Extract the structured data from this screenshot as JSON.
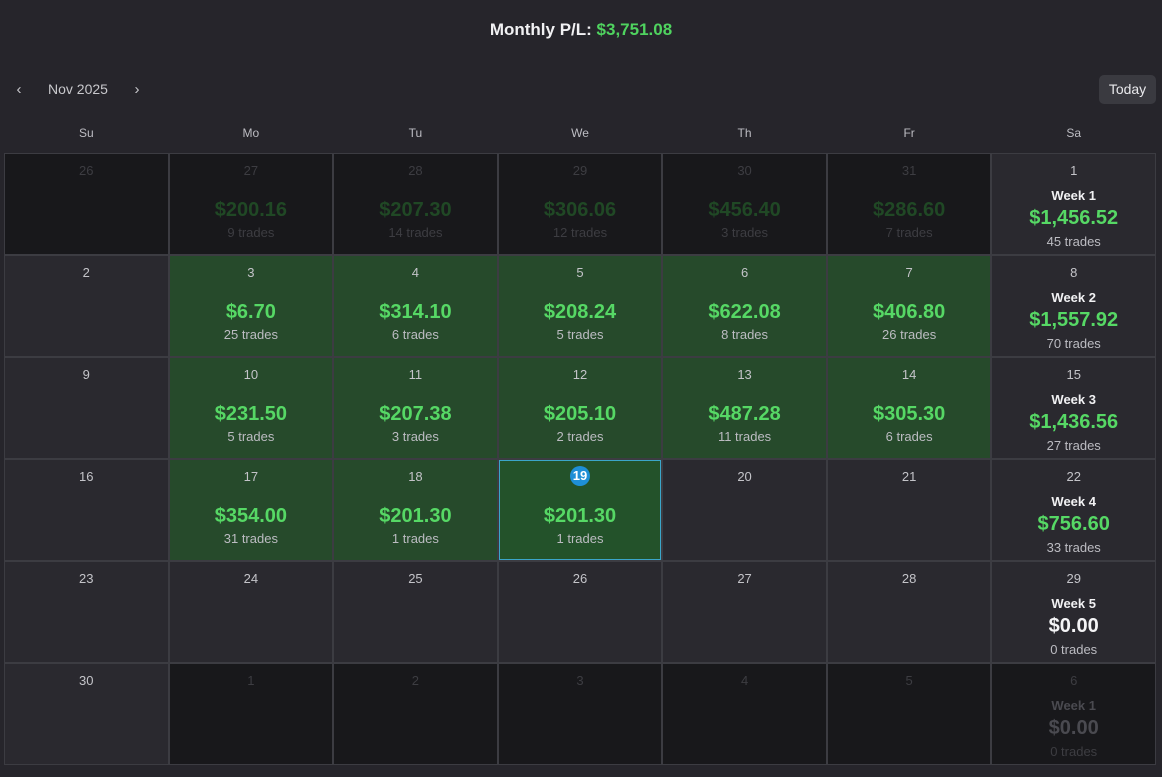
{
  "header": {
    "label": "Monthly P/L:",
    "value": "$3,751.08"
  },
  "nav": {
    "prev": "‹",
    "month": "Nov 2025",
    "next": "›",
    "today": "Today"
  },
  "dow": [
    "Su",
    "Mo",
    "Tu",
    "We",
    "Th",
    "Fr",
    "Sa"
  ],
  "weeks": [
    [
      {
        "day": "26",
        "outside": true
      },
      {
        "day": "27",
        "outside": true,
        "amount": "$200.16",
        "trades": "9 trades"
      },
      {
        "day": "28",
        "outside": true,
        "amount": "$207.30",
        "trades": "14 trades"
      },
      {
        "day": "29",
        "outside": true,
        "amount": "$306.06",
        "trades": "12 trades"
      },
      {
        "day": "30",
        "outside": true,
        "amount": "$456.40",
        "trades": "3 trades"
      },
      {
        "day": "31",
        "outside": true,
        "amount": "$286.60",
        "trades": "7 trades"
      },
      {
        "day": "1",
        "week": "Week 1",
        "week_amount": "$1,456.52",
        "week_trades": "45 trades"
      }
    ],
    [
      {
        "day": "2"
      },
      {
        "day": "3",
        "green": true,
        "amount": "$6.70",
        "trades": "25 trades"
      },
      {
        "day": "4",
        "green": true,
        "amount": "$314.10",
        "trades": "6 trades"
      },
      {
        "day": "5",
        "green": true,
        "amount": "$208.24",
        "trades": "5 trades"
      },
      {
        "day": "6",
        "green": true,
        "amount": "$622.08",
        "trades": "8 trades"
      },
      {
        "day": "7",
        "green": true,
        "amount": "$406.80",
        "trades": "26 trades"
      },
      {
        "day": "8",
        "week": "Week 2",
        "week_amount": "$1,557.92",
        "week_trades": "70 trades"
      }
    ],
    [
      {
        "day": "9"
      },
      {
        "day": "10",
        "green": true,
        "amount": "$231.50",
        "trades": "5 trades"
      },
      {
        "day": "11",
        "green": true,
        "amount": "$207.38",
        "trades": "3 trades"
      },
      {
        "day": "12",
        "green": true,
        "amount": "$205.10",
        "trades": "2 trades"
      },
      {
        "day": "13",
        "green": true,
        "amount": "$487.28",
        "trades": "11 trades"
      },
      {
        "day": "14",
        "green": true,
        "amount": "$305.30",
        "trades": "6 trades"
      },
      {
        "day": "15",
        "week": "Week 3",
        "week_amount": "$1,436.56",
        "week_trades": "27 trades"
      }
    ],
    [
      {
        "day": "16"
      },
      {
        "day": "17",
        "green": true,
        "amount": "$354.00",
        "trades": "31 trades"
      },
      {
        "day": "18",
        "green": true,
        "amount": "$201.30",
        "trades": "1 trades"
      },
      {
        "day": "19",
        "green": true,
        "today": true,
        "amount": "$201.30",
        "trades": "1 trades"
      },
      {
        "day": "20"
      },
      {
        "day": "21"
      },
      {
        "day": "22",
        "week": "Week 4",
        "week_amount": "$756.60",
        "week_trades": "33 trades"
      }
    ],
    [
      {
        "day": "23"
      },
      {
        "day": "24"
      },
      {
        "day": "25"
      },
      {
        "day": "26"
      },
      {
        "day": "27"
      },
      {
        "day": "28"
      },
      {
        "day": "29",
        "week": "Week 5",
        "week_amount": "$0.00",
        "week_trades": "0 trades",
        "zero": true
      }
    ],
    [
      {
        "day": "30"
      },
      {
        "day": "1",
        "outside": true
      },
      {
        "day": "2",
        "outside": true
      },
      {
        "day": "3",
        "outside": true
      },
      {
        "day": "4",
        "outside": true
      },
      {
        "day": "5",
        "outside": true
      },
      {
        "day": "6",
        "outside": true,
        "week": "Week 1",
        "week_amount": "$0.00",
        "week_trades": "0 trades",
        "zero": true
      }
    ]
  ],
  "colors": {
    "profit": "#56d865",
    "today_badge": "#1e8fd6",
    "today_border": "#3ba6c9"
  }
}
